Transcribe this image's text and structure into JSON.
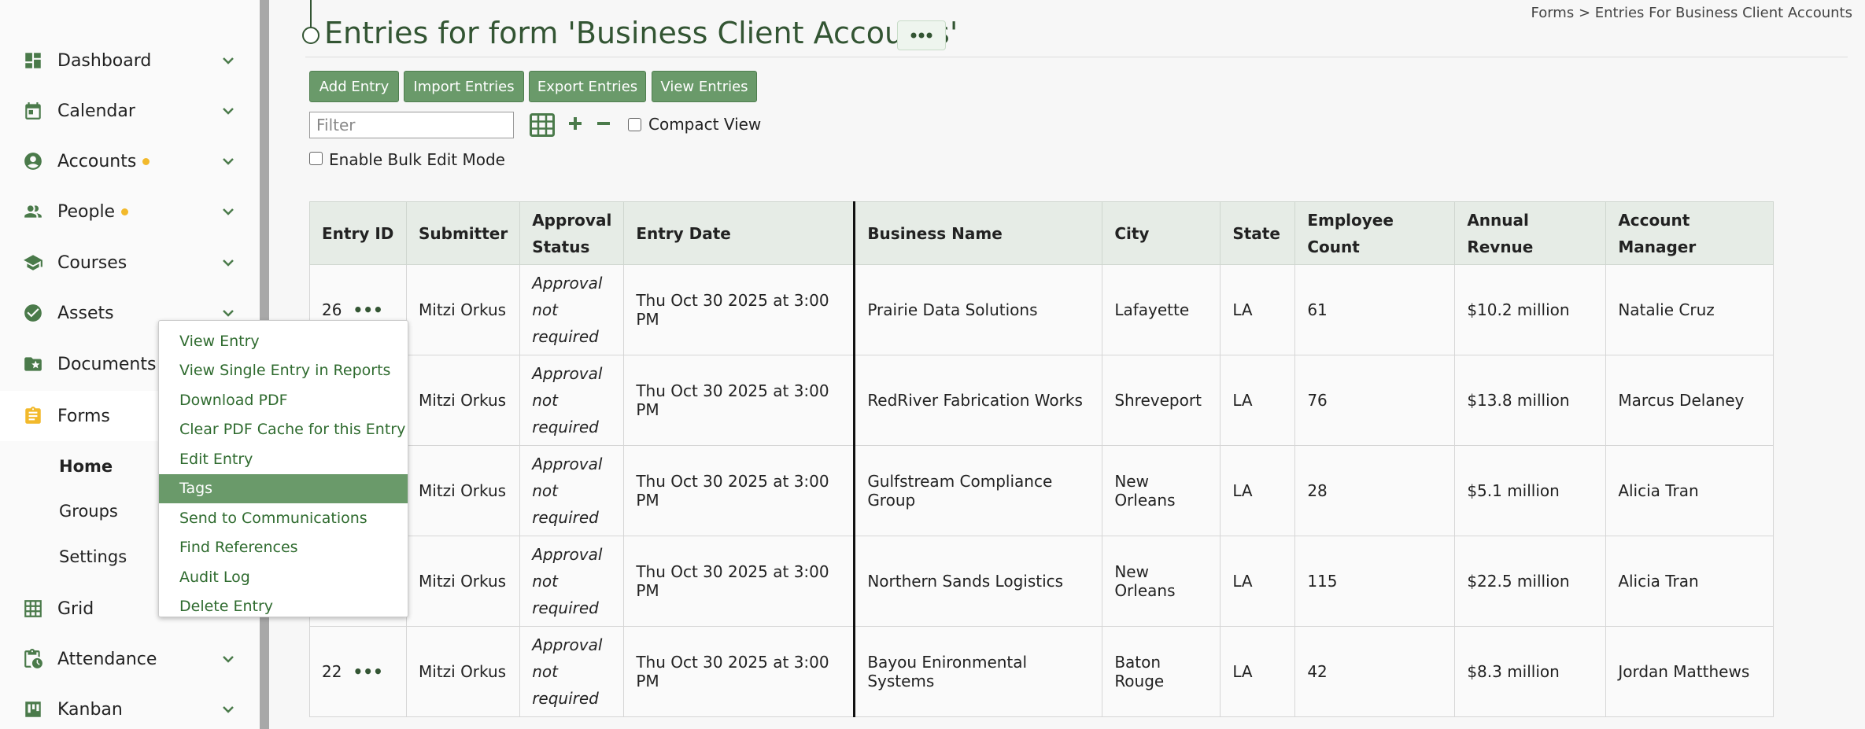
{
  "sidebar": {
    "items": [
      {
        "label": "Dashboard",
        "icon": "dashboard-icon",
        "chevron": true,
        "dot": false
      },
      {
        "label": "Calendar",
        "icon": "calendar-icon",
        "chevron": true,
        "dot": false
      },
      {
        "label": "Accounts",
        "icon": "account-circle-icon",
        "chevron": true,
        "dot": true
      },
      {
        "label": "People",
        "icon": "people-icon",
        "chevron": true,
        "dot": true
      },
      {
        "label": "Courses",
        "icon": "graduation-cap-icon",
        "chevron": true,
        "dot": false
      },
      {
        "label": "Assets",
        "icon": "check-circle-icon",
        "chevron": true,
        "dot": false
      },
      {
        "label": "Documents",
        "icon": "folder-star-icon",
        "chevron": false,
        "dot": false
      },
      {
        "label": "Forms",
        "icon": "clipboard-icon",
        "chevron": false,
        "dot": false
      },
      {
        "label": "Grid",
        "icon": "grid-icon",
        "chevron": false,
        "dot": false
      },
      {
        "label": "Attendance",
        "icon": "clipboard-clock-icon",
        "chevron": true,
        "dot": false
      },
      {
        "label": "Kanban",
        "icon": "kanban-icon",
        "chevron": true,
        "dot": false
      }
    ],
    "forms_sub": [
      "Home",
      "Groups",
      "Settings"
    ]
  },
  "header": {
    "title": "Entries for form 'Business Client Accounts'",
    "breadcrumb": "Forms  > Entries For Business Client Accounts"
  },
  "toolbar": {
    "add_entry": "Add Entry",
    "import_entries": "Import Entries",
    "export_entries": "Export Entries",
    "view_entries": "View Entries",
    "filter_placeholder": "Filter",
    "compact_view": "Compact View",
    "bulk_edit": "Enable Bulk Edit Mode"
  },
  "table": {
    "columns": [
      "Entry ID",
      "Submitter",
      "Approval Status",
      "Entry Date",
      "Business Name",
      "City",
      "State",
      "Employee Count",
      "Annual Revnue",
      "Account Manager"
    ],
    "rows": [
      {
        "id": "26",
        "submitter": "Mitzi Orkus",
        "status": "Approval not required",
        "date": "Thu Oct 30 2025 at 3:00 PM",
        "business": "Prairie Data Solutions",
        "city": "Lafayette",
        "state": "LA",
        "employees": "61",
        "revenue": "$10.2 million",
        "manager": "Natalie Cruz"
      },
      {
        "id": "",
        "submitter": "Mitzi Orkus",
        "status": "Approval not required",
        "date": "Thu Oct 30 2025 at 3:00 PM",
        "business": "RedRiver Fabrication Works",
        "city": "Shreveport",
        "state": "LA",
        "employees": "76",
        "revenue": "$13.8 million",
        "manager": "Marcus Delaney"
      },
      {
        "id": "",
        "submitter": "Mitzi Orkus",
        "status": "Approval not required",
        "date": "Thu Oct 30 2025 at 3:00 PM",
        "business": "Gulfstream Compliance Group",
        "city": "New Orleans",
        "state": "LA",
        "employees": "28",
        "revenue": "$5.1 million",
        "manager": "Alicia Tran"
      },
      {
        "id": "",
        "submitter": "Mitzi Orkus",
        "status": "Approval not required",
        "date": "Thu Oct 30 2025 at 3:00 PM",
        "business": "Northern Sands Logistics",
        "city": "New Orleans",
        "state": "LA",
        "employees": "115",
        "revenue": "$22.5 million",
        "manager": "Alicia Tran"
      },
      {
        "id": "22",
        "submitter": "Mitzi Orkus",
        "status": "Approval not required",
        "date": "Thu Oct 30 2025 at 3:00 PM",
        "business": "Bayou Enironmental Systems",
        "city": "Baton Rouge",
        "state": "LA",
        "employees": "42",
        "revenue": "$8.3 million",
        "manager": "Jordan Matthews"
      }
    ]
  },
  "context_menu": {
    "items": [
      "View Entry",
      "View Single Entry in Reports",
      "Download PDF",
      "Clear PDF Cache for this Entry",
      "Edit Entry",
      "Tags",
      "Send to Communications",
      "Find References",
      "Audit Log",
      "Delete Entry"
    ],
    "highlighted": "Tags"
  },
  "colors": {
    "accent": "#6a9a6a",
    "title": "#335533",
    "icon": "#4a7a4a",
    "dot": "#f2b92b",
    "forms_icon": "#f2b92b"
  }
}
